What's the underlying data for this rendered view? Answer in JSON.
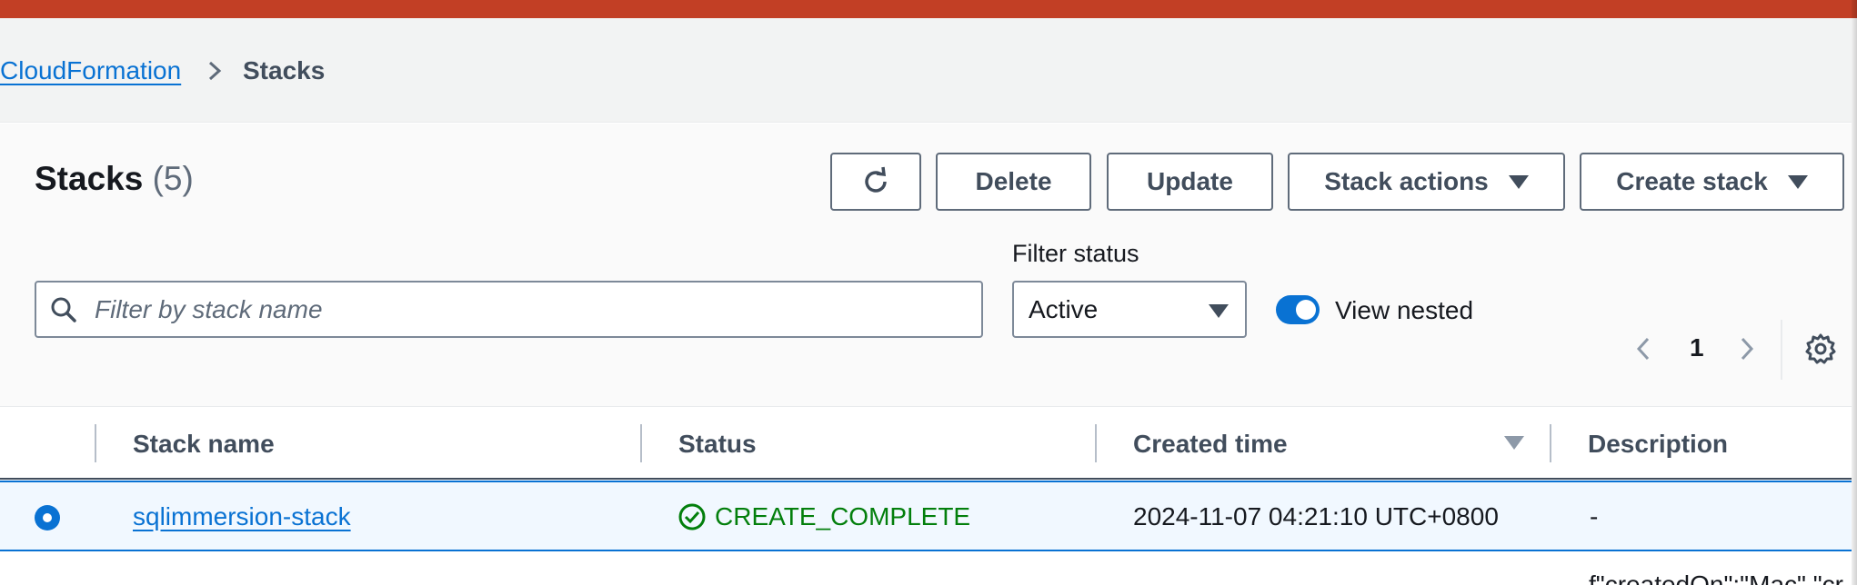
{
  "breadcrumb": {
    "parent": "CloudFormation",
    "current": "Stacks"
  },
  "header": {
    "title": "Stacks",
    "count": "(5)"
  },
  "toolbar": {
    "delete_label": "Delete",
    "update_label": "Update",
    "stack_actions_label": "Stack actions",
    "create_stack_label": "Create stack"
  },
  "filters": {
    "search_placeholder": "Filter by stack name",
    "status_label": "Filter status",
    "status_value": "Active",
    "view_nested_label": "View nested",
    "view_nested_enabled": true
  },
  "pagination": {
    "current_page": "1"
  },
  "table": {
    "columns": [
      "Stack name",
      "Status",
      "Created time",
      "Description"
    ],
    "rows": [
      {
        "stack_name": "sqlimmersion-stack",
        "status": "CREATE_COMPLETE",
        "created_time": "2024-11-07 04:21:10 UTC+0800",
        "description": "-",
        "selected": true
      }
    ],
    "partial_text": "f\"createdOn\":\"Mac\",\"cr"
  },
  "colors": {
    "top_bar": "#c23f25",
    "link_blue": "#0972d3",
    "success_green": "#037f0c",
    "selected_row_bg": "#f1f8ff"
  },
  "icons": [
    "chevron-right-icon",
    "refresh-icon",
    "caret-down-icon",
    "search-icon",
    "chevron-left-icon",
    "settings-icon",
    "check-circle-icon",
    "sort-descending-icon"
  ]
}
